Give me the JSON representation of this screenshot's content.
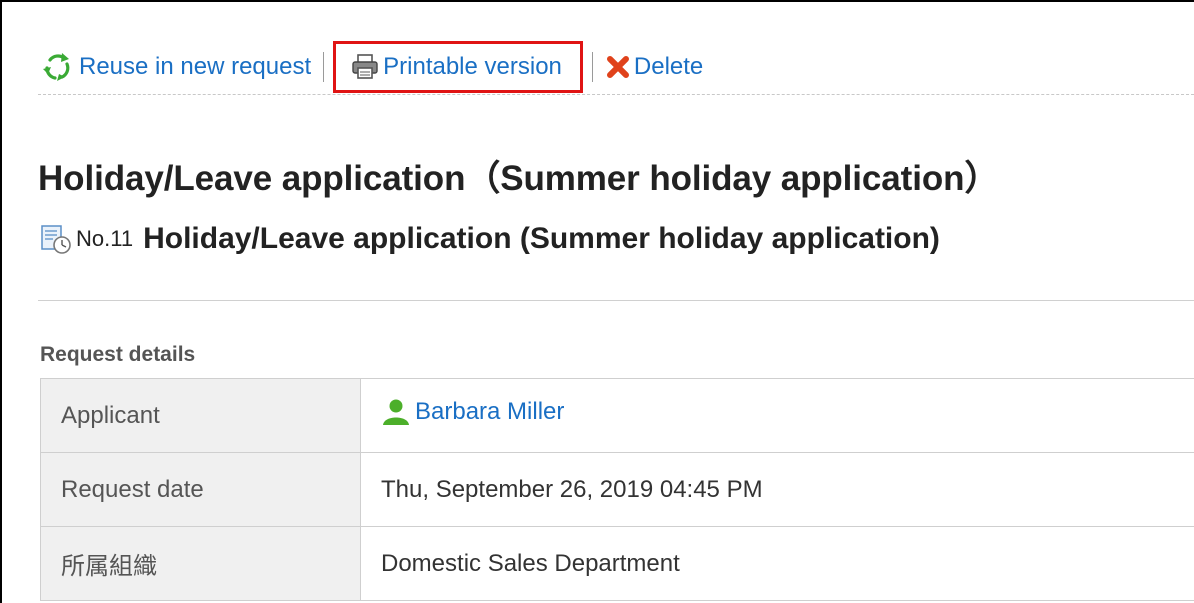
{
  "toolbar": {
    "reuse_label": "Reuse in new request",
    "printable_label": "Printable version",
    "delete_label": "Delete"
  },
  "page_title": "Holiday/Leave application（Summer holiday application）",
  "request": {
    "number": "No.11",
    "subtitle": "Holiday/Leave application (Summer holiday application)"
  },
  "details": {
    "section_label": "Request details",
    "rows": [
      {
        "label": "Applicant",
        "value": "Barbara Miller"
      },
      {
        "label": "Request date",
        "value": "Thu, September 26, 2019 04:45 PM"
      },
      {
        "label": "所属組織",
        "value": "Domestic Sales Department"
      }
    ]
  },
  "icons": {
    "reuse": "recycle-icon",
    "print": "printer-icon",
    "delete": "delete-x-icon",
    "request": "request-document-icon",
    "user": "user-icon"
  },
  "colors": {
    "link": "#1a6fc4",
    "highlight_border": "#e01414",
    "delete_x": "#e0421b",
    "recycle_green": "#3aaa35",
    "user_green": "#4caf2a"
  }
}
